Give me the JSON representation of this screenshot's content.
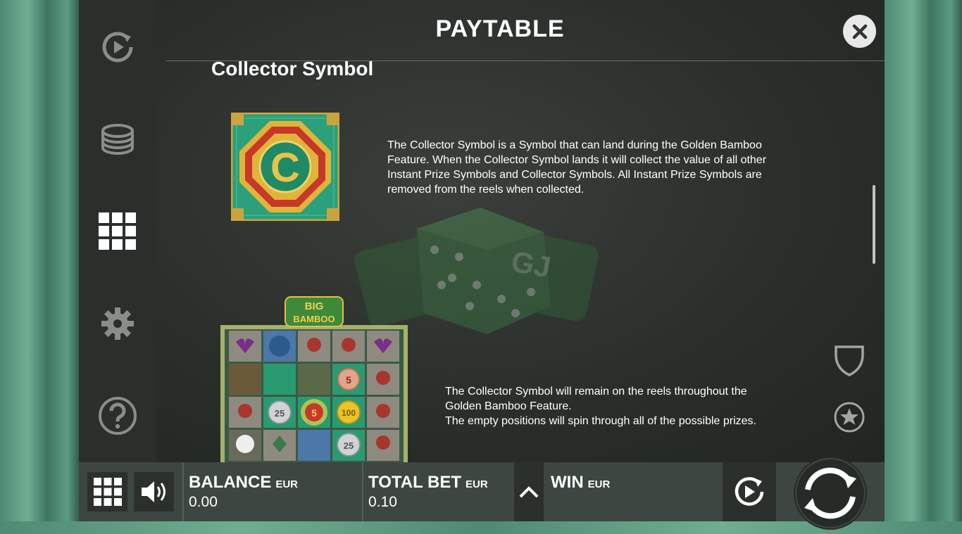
{
  "header": {
    "title": "PAYTABLE"
  },
  "paytable": {
    "section_title": "Collector Symbol",
    "symbol_letter": "C",
    "description_1": "The Collector Symbol is a Symbol that can land during the Golden Bamboo Feature. When the Collector Symbol lands it will collect the value of all other Instant Prize Symbols and Collector Symbols. All Instant Prize Symbols are removed from the reels when collected.",
    "description_2": "The Collector Symbol will remain on the reels throughout the Golden Bamboo Feature.\nThe empty positions will spin through all of the possible prizes.",
    "preview": {
      "logo_line1": "BIG",
      "logo_line2": "BAMBOO",
      "values": [
        "5",
        "25",
        "5",
        "100",
        "25"
      ]
    }
  },
  "watermark_letters": "GJ",
  "bottom_bar": {
    "balance_label": "BALANCE",
    "balance_currency": "EUR",
    "balance_value": "0.00",
    "bet_label": "TOTAL BET",
    "bet_currency": "EUR",
    "bet_value": "0.10",
    "win_label": "WIN",
    "win_currency": "EUR"
  },
  "icons": [
    "autoplay-icon",
    "coins-icon",
    "paytable-grid-icon",
    "gear-icon",
    "help-icon",
    "close-icon",
    "shield-icon",
    "star-icon",
    "menu-grid-icon",
    "speaker-icon",
    "chevron-up-icon",
    "autoplay-icon",
    "spin-icon"
  ],
  "colors": {
    "accent_green": "#2f9a77",
    "gold": "#e0b43a",
    "red": "#c8382a"
  }
}
